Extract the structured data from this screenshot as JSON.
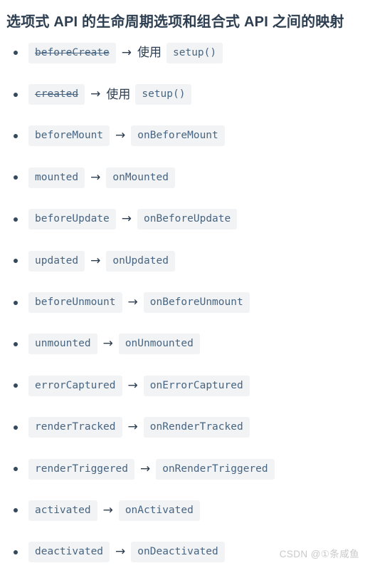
{
  "page": {
    "background_color": "#ffffff",
    "title": "选项式 API 的生命周期选项和组合式 API 之间的映射"
  },
  "colors": {
    "title_text": "#2c3e50",
    "code_text": "#476582",
    "code_background": "#f2f3f4",
    "arrow_text": "#2c3e50",
    "bullet": "#34495e",
    "watermark": "#c9c9c9"
  },
  "list": {
    "arrow_glyph": "→",
    "items": [
      {
        "option_api": "beforeCreate",
        "struck": true,
        "note": "使用",
        "composition_api": "setup()"
      },
      {
        "option_api": "created",
        "struck": true,
        "note": "使用",
        "composition_api": "setup()"
      },
      {
        "option_api": "beforeMount",
        "struck": false,
        "note": "",
        "composition_api": "onBeforeMount"
      },
      {
        "option_api": "mounted",
        "struck": false,
        "note": "",
        "composition_api": "onMounted"
      },
      {
        "option_api": "beforeUpdate",
        "struck": false,
        "note": "",
        "composition_api": "onBeforeUpdate"
      },
      {
        "option_api": "updated",
        "struck": false,
        "note": "",
        "composition_api": "onUpdated"
      },
      {
        "option_api": "beforeUnmount",
        "struck": false,
        "note": "",
        "composition_api": "onBeforeUnmount"
      },
      {
        "option_api": "unmounted",
        "struck": false,
        "note": "",
        "composition_api": "onUnmounted"
      },
      {
        "option_api": "errorCaptured",
        "struck": false,
        "note": "",
        "composition_api": "onErrorCaptured"
      },
      {
        "option_api": "renderTracked",
        "struck": false,
        "note": "",
        "composition_api": "onRenderTracked"
      },
      {
        "option_api": "renderTriggered",
        "struck": false,
        "note": "",
        "composition_api": "onRenderTriggered"
      },
      {
        "option_api": "activated",
        "struck": false,
        "note": "",
        "composition_api": "onActivated"
      },
      {
        "option_api": "deactivated",
        "struck": false,
        "note": "",
        "composition_api": "onDeactivated"
      }
    ]
  },
  "watermark": {
    "text": "CSDN @①条咸鱼"
  }
}
